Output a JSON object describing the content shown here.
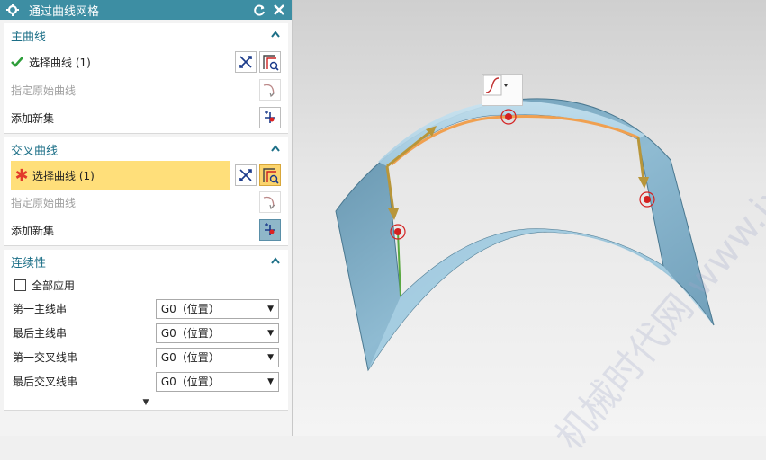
{
  "dialog": {
    "title": "通过曲线网格"
  },
  "primary": {
    "header": "主曲线",
    "select_label": "选择曲线 (1)",
    "origin_label": "指定原始曲线",
    "add_set_label": "添加新集"
  },
  "cross": {
    "header": "交叉曲线",
    "select_label": "选择曲线 (1)",
    "origin_label": "指定原始曲线",
    "add_set_label": "添加新集"
  },
  "continuity": {
    "header": "连续性",
    "apply_all_label": "全部应用",
    "apply_all_checked": false,
    "rows": [
      {
        "label": "第一主线串",
        "value": "G0（位置）"
      },
      {
        "label": "最后主线串",
        "value": "G0（位置）"
      },
      {
        "label": "第一交叉线串",
        "value": "G0（位置）"
      },
      {
        "label": "最后交叉线串",
        "value": "G0（位置）"
      }
    ]
  },
  "watermark": "机械时代网 www.jxage.com",
  "colors": {
    "title_bar": "#3d8ea3",
    "section_header": "#1c6f87",
    "highlight": "#ffdf7a",
    "surface": "#7fb0c9",
    "curve": "#f0a050",
    "point": "#d42020"
  }
}
